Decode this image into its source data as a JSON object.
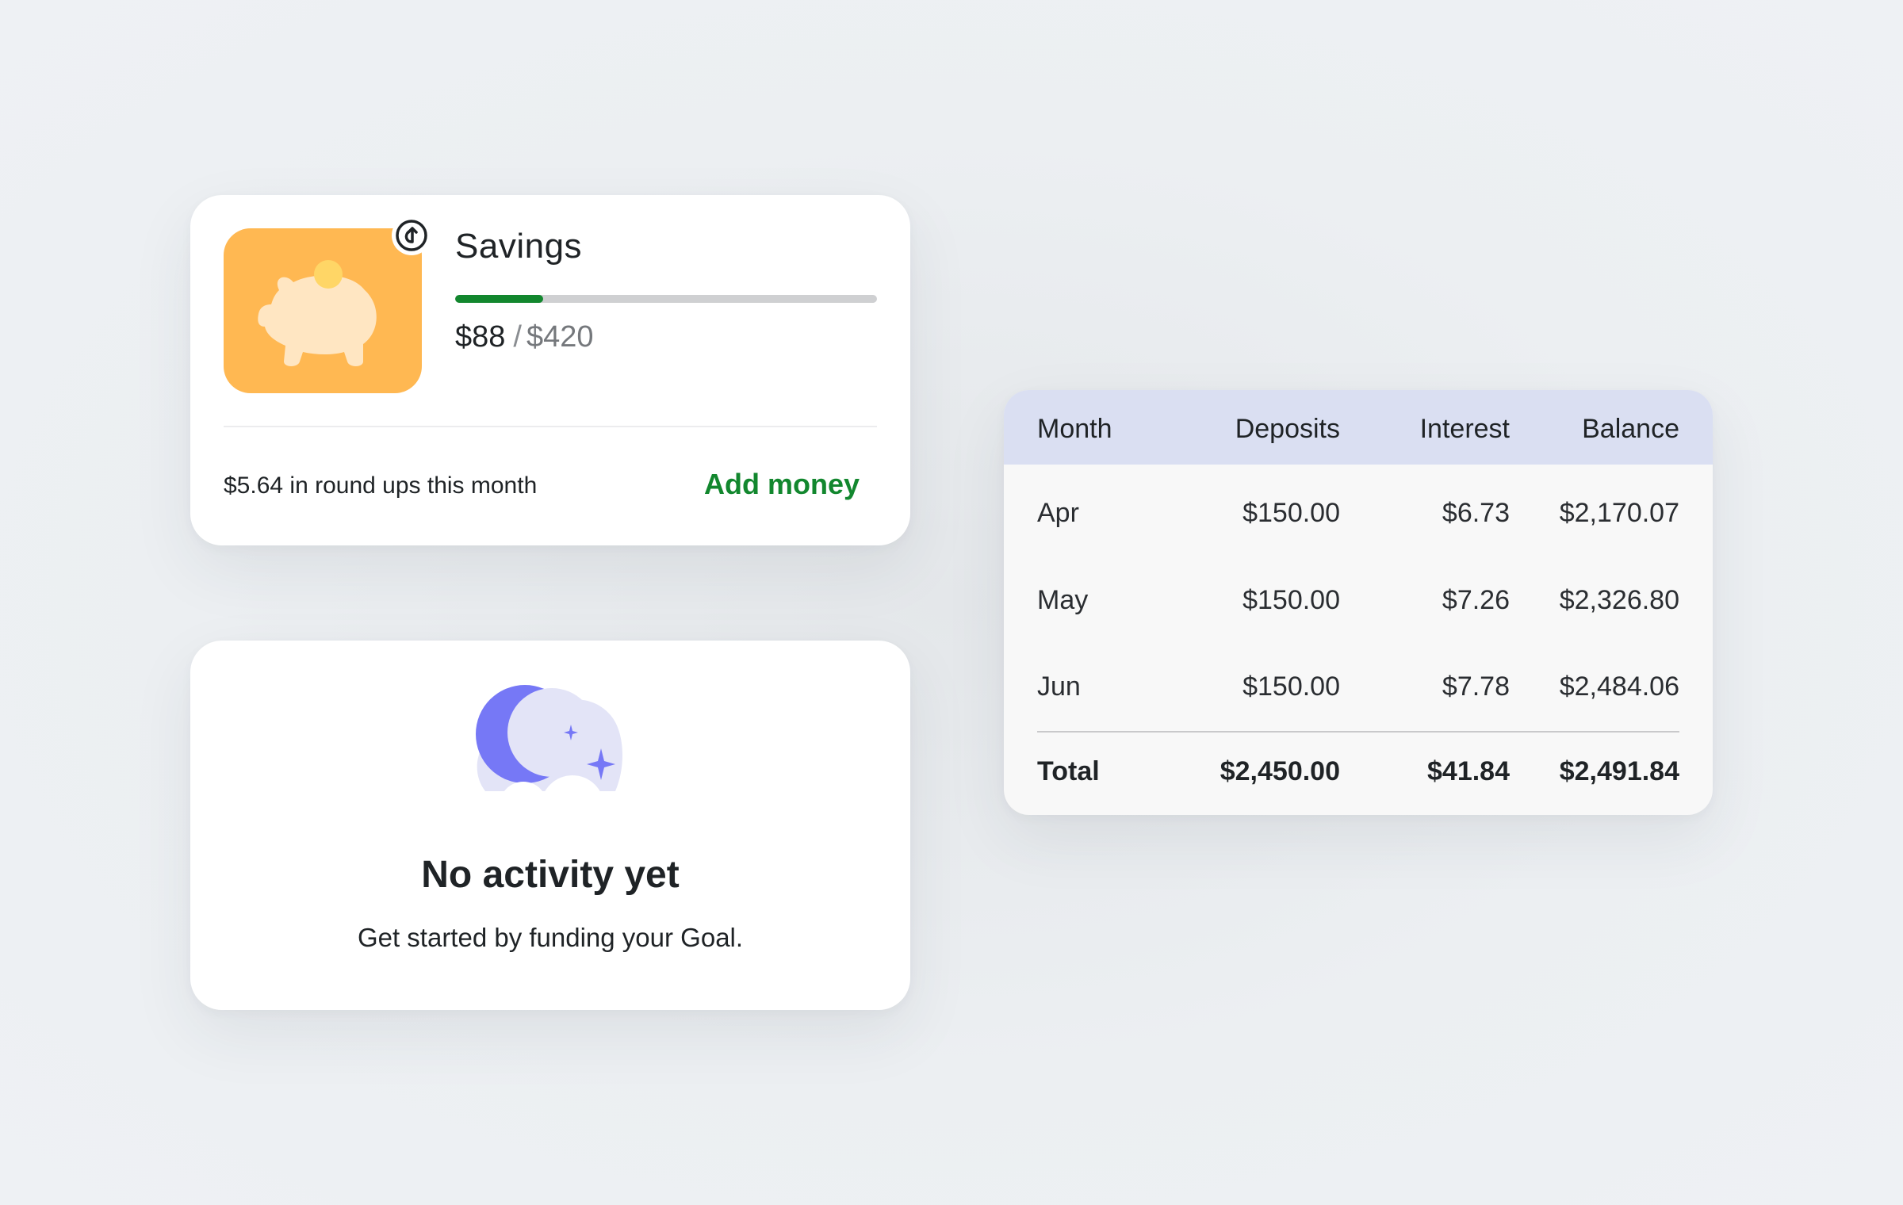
{
  "colors": {
    "accent_green": "#12872e",
    "goal_tile": "#ffb852",
    "table_header": "#dadff2",
    "illustration_purple": "#7678f6"
  },
  "savings": {
    "icon": "piggy-bank-icon",
    "badge_icon": "round-up-icon",
    "title": "Savings",
    "current": "$88",
    "separator": "/",
    "target": "$420",
    "progress_fraction": 0.2095,
    "roundups_text": "$5.64 in round ups this month",
    "add_money_label": "Add money"
  },
  "activity": {
    "icon": "moon-stars-icon",
    "title": "No activity yet",
    "subtitle": "Get started by funding your Goal."
  },
  "interest_table": {
    "headers": [
      "Month",
      "Deposits",
      "Interest",
      "Balance"
    ],
    "rows": [
      [
        "Apr",
        "$150.00",
        "$6.73",
        "$2,170.07"
      ],
      [
        "May",
        "$150.00",
        "$7.26",
        "$2,326.80"
      ],
      [
        "Jun",
        "$150.00",
        "$7.78",
        "$2,484.06"
      ]
    ],
    "total": [
      "Total",
      "$2,450.00",
      "$41.84",
      "$2,491.84"
    ]
  }
}
